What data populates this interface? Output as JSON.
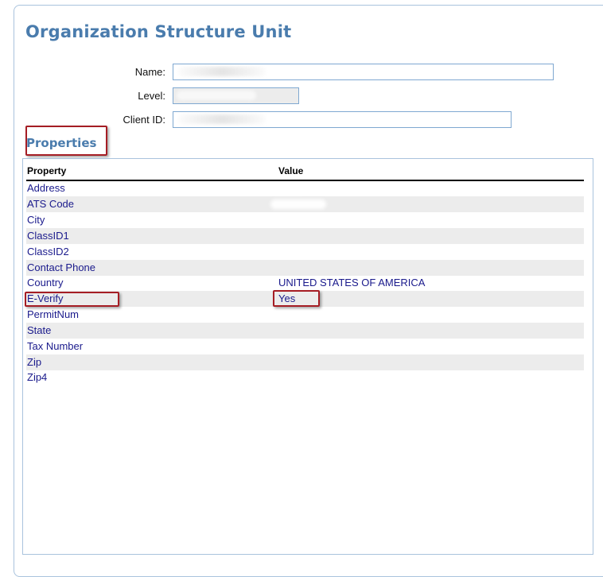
{
  "page": {
    "title": "Organization Structure Unit"
  },
  "form": {
    "name_label": "Name:",
    "level_label": "Level:",
    "client_id_label": "Client ID:",
    "name_value": "",
    "level_value": "",
    "client_id_value": ""
  },
  "properties": {
    "heading": "Properties",
    "columns": {
      "property": "Property",
      "value": "Value"
    },
    "rows": [
      {
        "property": "Address",
        "value": ""
      },
      {
        "property": "ATS Code",
        "value": ""
      },
      {
        "property": "City",
        "value": ""
      },
      {
        "property": "ClassID1",
        "value": ""
      },
      {
        "property": "ClassID2",
        "value": ""
      },
      {
        "property": "Contact Phone",
        "value": ""
      },
      {
        "property": "Country",
        "value": "UNITED STATES OF AMERICA"
      },
      {
        "property": "E-Verify",
        "value": "Yes"
      },
      {
        "property": "PermitNum",
        "value": ""
      },
      {
        "property": "State",
        "value": ""
      },
      {
        "property": "Tax Number",
        "value": ""
      },
      {
        "property": "Zip",
        "value": ""
      },
      {
        "property": "Zip4",
        "value": ""
      }
    ]
  },
  "colors": {
    "title": "#4a7cad",
    "link_text": "#1a1a8c",
    "alt_row": "#ececec",
    "annotation_red": "#a51d24",
    "field_border": "#7fa8d1"
  }
}
